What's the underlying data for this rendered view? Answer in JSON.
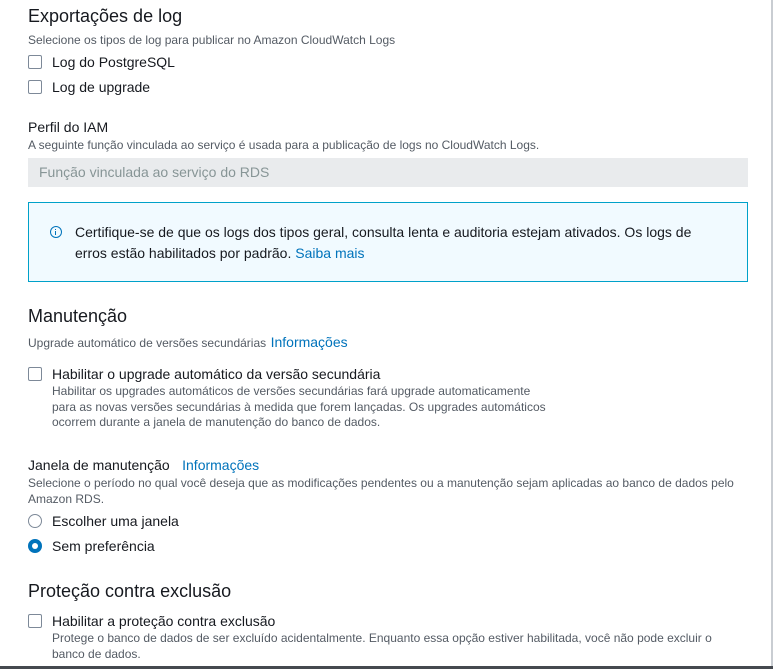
{
  "log_exports": {
    "title": "Exportações de log",
    "description": "Selecione os tipos de log para publicar no Amazon CloudWatch Logs",
    "options": [
      {
        "label": "Log do PostgreSQL",
        "checked": false
      },
      {
        "label": "Log de upgrade",
        "checked": false
      }
    ]
  },
  "iam": {
    "label": "Perfil do IAM",
    "description": "A seguinte função vinculada ao serviço é usada para a publicação de logs no CloudWatch Logs.",
    "field_value": "Função vinculada ao serviço do RDS"
  },
  "info_alert": {
    "icon": "info-circle-icon",
    "text": "Certifique-se de que os logs dos tipos geral, consulta lenta e auditoria estejam ativados. Os logs de erros estão habilitados por padrão.",
    "link": "Saiba mais"
  },
  "maintenance": {
    "title": "Manutenção",
    "auto_upgrade_description": "Upgrade automático de versões secundárias",
    "info_link": "Informações",
    "auto_upgrade_checkbox": {
      "label": "Habilitar o upgrade automático da versão secundária",
      "checked": false,
      "help_lines": [
        "Habilitar os upgrades automáticos de versões secundárias fará upgrade automaticamente",
        "para as novas versões secundárias à medida que forem lançadas. Os upgrades automáticos",
        "ocorrem durante a janela de manutenção do banco de dados."
      ]
    },
    "window": {
      "label": "Janela de manutenção",
      "info_link": "Informações",
      "description_lines": [
        "Selecione o período no qual você deseja que as modificações pendentes ou a manutenção sejam aplicadas ao banco de dados pelo",
        "Amazon RDS."
      ],
      "options": [
        {
          "label": "Escolher uma janela",
          "selected": false
        },
        {
          "label": "Sem preferência",
          "selected": true
        }
      ]
    }
  },
  "deletion_protection": {
    "title": "Proteção contra exclusão",
    "checkbox": {
      "label": "Habilitar a proteção contra exclusão",
      "checked": false,
      "help_lines": [
        "Protege o banco de dados de ser excluído acidentalmente. Enquanto essa opção estiver habilitada, você não pode excluir o",
        "banco de dados."
      ]
    }
  },
  "colors": {
    "link": "#0073bb",
    "alert_border": "#00a1c9",
    "alert_bg": "#f1faff",
    "field_bg": "#e9ebed"
  }
}
